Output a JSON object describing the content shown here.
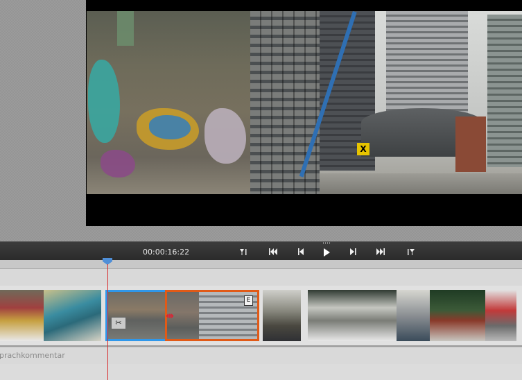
{
  "transport": {
    "timecode": "00:00:16:22",
    "buttons": [
      {
        "name": "go-to-in-point-button",
        "icon": "mark-in-icon"
      },
      {
        "name": "go-to-previous-edit-button",
        "icon": "skip-back-icon"
      },
      {
        "name": "step-back-button",
        "icon": "step-back-icon"
      },
      {
        "name": "play-button",
        "icon": "play-icon"
      },
      {
        "name": "step-forward-button",
        "icon": "step-forward-icon"
      },
      {
        "name": "go-to-next-edit-button",
        "icon": "skip-forward-icon"
      },
      {
        "name": "go-to-out-point-button",
        "icon": "mark-out-icon"
      }
    ]
  },
  "timeline": {
    "narration_track_label": "prachkommentar",
    "clip_marker_glyph": "E",
    "accent_colors": {
      "playhead": "#d8282a",
      "selection_blue": "#2f97ea",
      "selection_orange": "#e15a17"
    }
  },
  "preview": {
    "sign_glyph": "X"
  }
}
